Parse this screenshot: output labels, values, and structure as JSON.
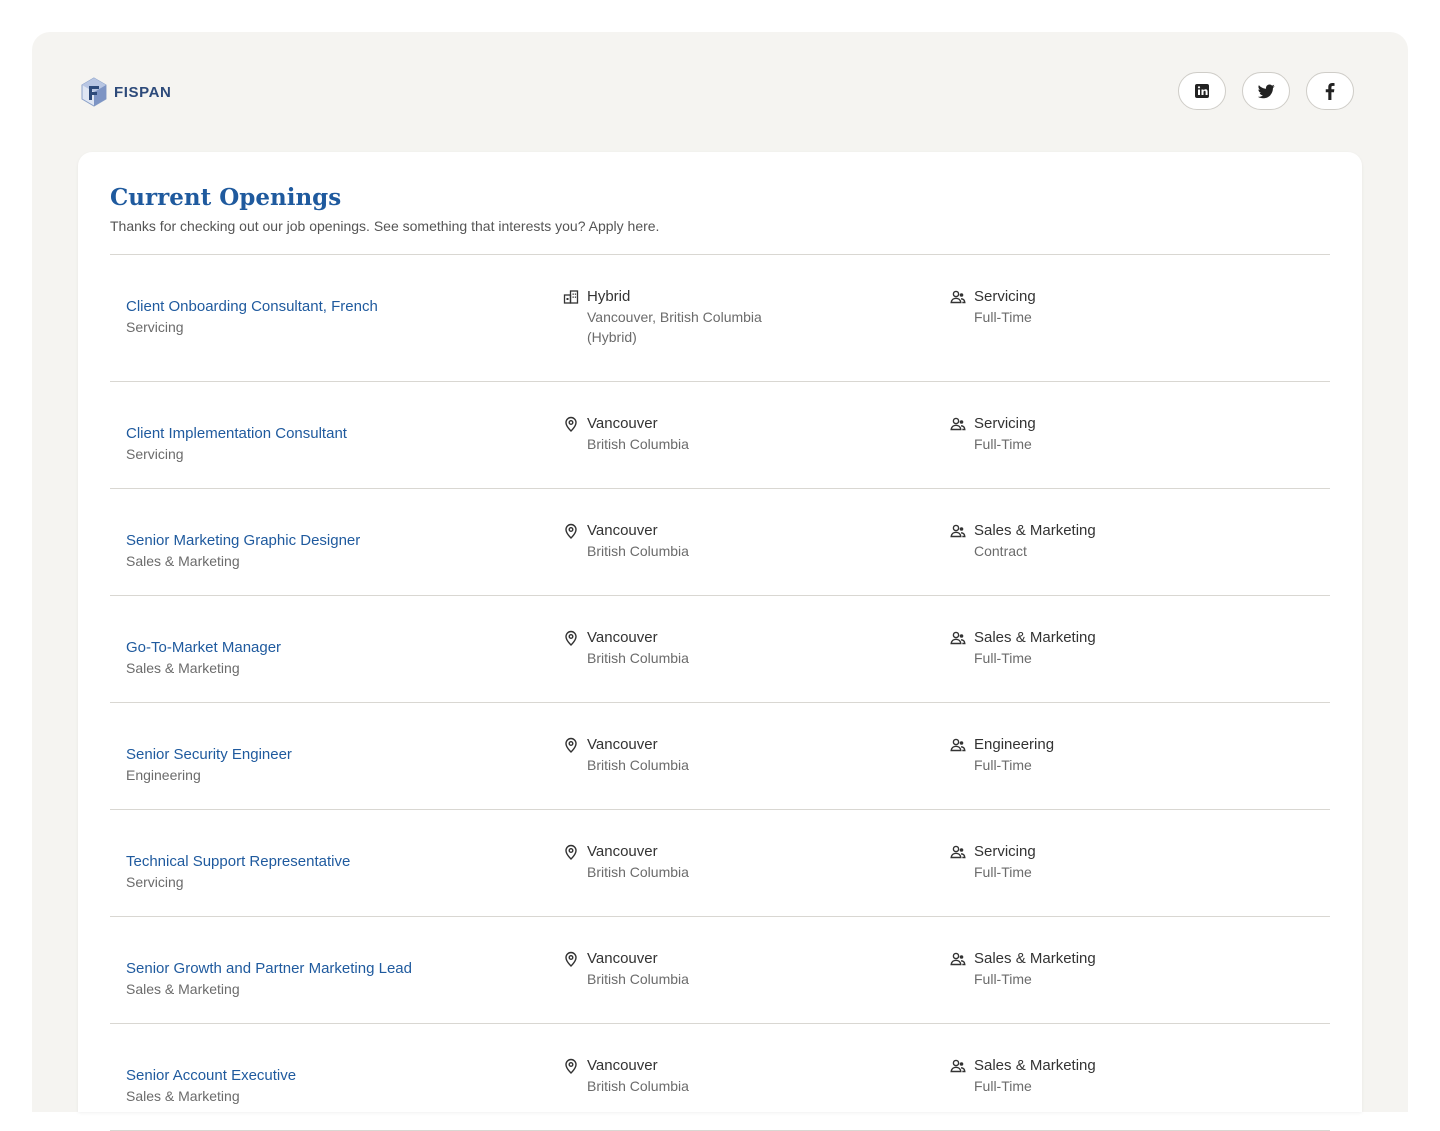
{
  "brand": {
    "name": "FISPAN",
    "colors": {
      "accent": "#1f5a9e",
      "background": "#f5f4f1"
    }
  },
  "socials": [
    {
      "icon": "linkedin-icon"
    },
    {
      "icon": "twitter-icon"
    },
    {
      "icon": "facebook-icon"
    }
  ],
  "openings": {
    "title": "Current Openings",
    "subtitle": "Thanks for checking out our job openings. See something that interests you? Apply here.",
    "jobs": [
      {
        "title": "Client Onboarding Consultant, French",
        "team": "Servicing",
        "location_type": "Hybrid",
        "location": "Vancouver, British Columbia (Hybrid)",
        "location_icon": "office-icon",
        "department": "Servicing",
        "employment": "Full-Time"
      },
      {
        "title": "Client Implementation Consultant",
        "team": "Servicing",
        "location_type": "Vancouver",
        "location": "British Columbia",
        "location_icon": "pin-icon",
        "department": "Servicing",
        "employment": "Full-Time"
      },
      {
        "title": "Senior Marketing Graphic Designer",
        "team": "Sales & Marketing",
        "location_type": "Vancouver",
        "location": "British Columbia",
        "location_icon": "pin-icon",
        "department": "Sales & Marketing",
        "employment": "Contract"
      },
      {
        "title": "Go-To-Market Manager",
        "team": "Sales & Marketing",
        "location_type": "Vancouver",
        "location": "British Columbia",
        "location_icon": "pin-icon",
        "department": "Sales & Marketing",
        "employment": "Full-Time"
      },
      {
        "title": "Senior Security Engineer",
        "team": "Engineering",
        "location_type": "Vancouver",
        "location": "British Columbia",
        "location_icon": "pin-icon",
        "department": "Engineering",
        "employment": "Full-Time"
      },
      {
        "title": "Technical Support Representative",
        "team": "Servicing",
        "location_type": "Vancouver",
        "location": "British Columbia",
        "location_icon": "pin-icon",
        "department": "Servicing",
        "employment": "Full-Time"
      },
      {
        "title": "Senior Growth and Partner Marketing Lead",
        "team": "Sales & Marketing",
        "location_type": "Vancouver",
        "location": "British Columbia",
        "location_icon": "pin-icon",
        "department": "Sales & Marketing",
        "employment": "Full-Time"
      },
      {
        "title": "Senior Account Executive",
        "team": "Sales & Marketing",
        "location_type": "Vancouver",
        "location": "British Columbia",
        "location_icon": "pin-icon",
        "department": "Sales & Marketing",
        "employment": "Full-Time"
      }
    ]
  }
}
